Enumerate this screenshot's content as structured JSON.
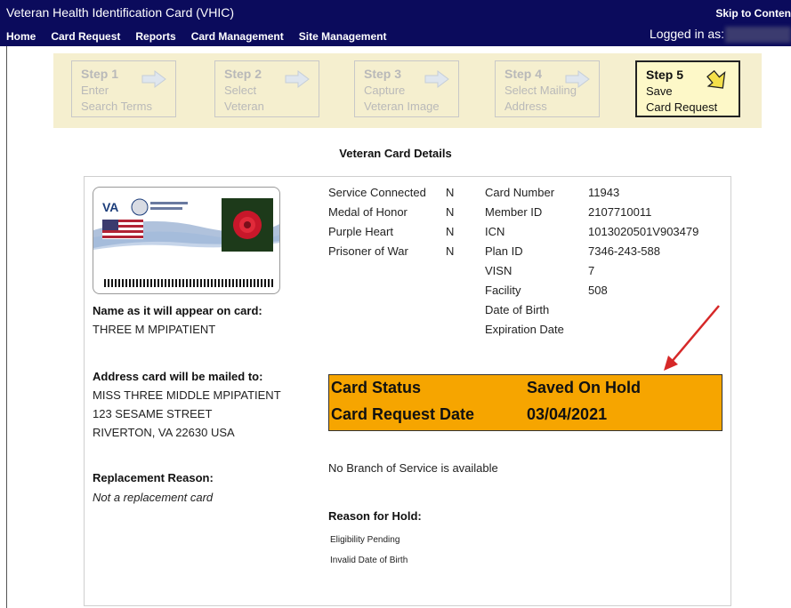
{
  "header": {
    "app_title": "Veteran Health Identification Card (VHIC)",
    "skip_link": "Skip to Content",
    "logged_in_label": "Logged in as:",
    "nav": [
      "Home",
      "Card Request",
      "Reports",
      "Card Management",
      "Site Management"
    ]
  },
  "steps": [
    {
      "num": "Step 1",
      "line1": "Enter",
      "line2": "Search Terms",
      "active": false
    },
    {
      "num": "Step 2",
      "line1": "Select",
      "line2": "Veteran",
      "active": false
    },
    {
      "num": "Step 3",
      "line1": "Capture",
      "line2": "Veteran Image",
      "active": false
    },
    {
      "num": "Step 4",
      "line1": "Select Mailing",
      "line2": "Address",
      "active": false
    },
    {
      "num": "Step 5",
      "line1": "Save",
      "line2": "Card Request",
      "active": true
    }
  ],
  "section_title": "Veteran Card Details",
  "card": {
    "name_label": "Name as it will appear on card:",
    "name_value": "THREE M MPIPATIENT",
    "address_label": "Address card will be mailed to:",
    "address_lines": [
      "MISS THREE MIDDLE MPIPATIENT",
      "123 SESAME STREET",
      "RIVERTON, VA 22630 USA"
    ],
    "replacement_label": "Replacement Reason:",
    "replacement_value": "Not a replacement card"
  },
  "flags": [
    {
      "label": "Service Connected",
      "value": "N"
    },
    {
      "label": "Medal of Honor",
      "value": "N"
    },
    {
      "label": "Purple Heart",
      "value": "N"
    },
    {
      "label": "Prisoner of War",
      "value": "N"
    }
  ],
  "ids": [
    {
      "label": "Card Number",
      "value": "11943"
    },
    {
      "label": "Member ID",
      "value": "2107710011"
    },
    {
      "label": "ICN",
      "value": "1013020501V903479"
    },
    {
      "label": "Plan ID",
      "value": "7346-243-588"
    },
    {
      "label": "VISN",
      "value": "7"
    },
    {
      "label": "Facility",
      "value": "508"
    },
    {
      "label": "Date of Birth",
      "value": ""
    },
    {
      "label": "Expiration Date",
      "value": ""
    }
  ],
  "status": {
    "status_label": "Card Status",
    "status_value": "Saved On Hold",
    "date_label": "Card Request Date",
    "date_value": "03/04/2021",
    "color": "#f6a500"
  },
  "branch_text": "No Branch of Service is available",
  "hold": {
    "label": "Reason for Hold:",
    "reasons": [
      "Eligibility Pending",
      "Invalid Date of Birth"
    ]
  },
  "colors": {
    "header_bg": "#0b0b5c",
    "steps_bg": "#f5efcf",
    "annotation_arrow": "#d62828"
  }
}
